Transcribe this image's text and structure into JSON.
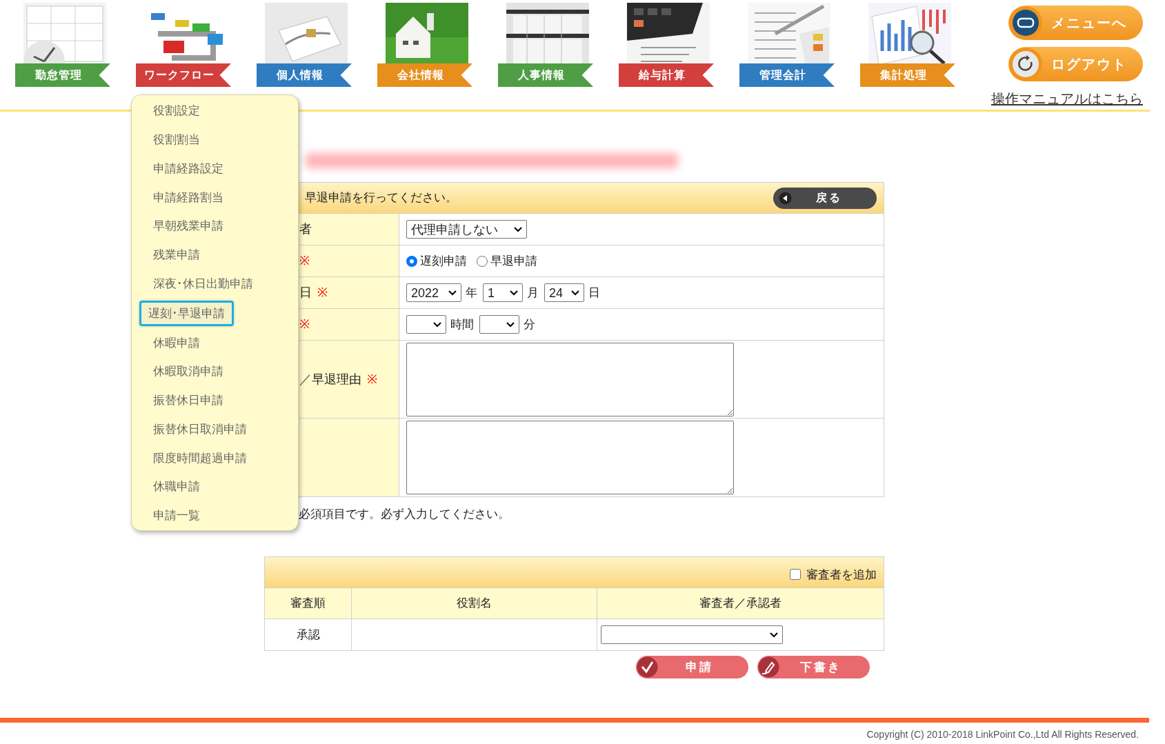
{
  "nav": [
    {
      "label": "勤怠管理",
      "color": "#4f9e45"
    },
    {
      "label": "ワークフロー",
      "color": "#d23f3c"
    },
    {
      "label": "個人情報",
      "color": "#2f7cc0"
    },
    {
      "label": "会社情報",
      "color": "#e68f1c"
    },
    {
      "label": "人事情報",
      "color": "#4f9e45"
    },
    {
      "label": "給与計算",
      "color": "#d23f3c"
    },
    {
      "label": "管理会計",
      "color": "#2f7cc0"
    },
    {
      "label": "集計処理",
      "color": "#e68f1c"
    }
  ],
  "header_buttons": [
    {
      "label": "メニューへ",
      "kind": "menu"
    },
    {
      "label": "ログアウト",
      "kind": "logout"
    }
  ],
  "manual_link": "操作マニュアルはこちら",
  "dropdown": [
    {
      "label": "役割設定",
      "selected": false
    },
    {
      "label": "役割割当",
      "selected": false
    },
    {
      "label": "申請経路設定",
      "selected": false
    },
    {
      "label": "申請経路割当",
      "selected": false
    },
    {
      "label": "早朝残業申請",
      "selected": false
    },
    {
      "label": "残業申請",
      "selected": false
    },
    {
      "label": "深夜･休日出勤申請",
      "selected": false
    },
    {
      "label": "遅刻･早退申請",
      "selected": true
    },
    {
      "label": "休暇申請",
      "selected": false
    },
    {
      "label": "休暇取消申請",
      "selected": false
    },
    {
      "label": "振替休日申請",
      "selected": false
    },
    {
      "label": "振替休日取消申請",
      "selected": false
    },
    {
      "label": "限度時間超過申請",
      "selected": false
    },
    {
      "label": "休職申請",
      "selected": false
    },
    {
      "label": "申請一覧",
      "selected": false
    }
  ],
  "form": {
    "instruction": "早退申請を行ってください。",
    "back_button": "戻る",
    "rows": [
      {
        "label": "者",
        "required": false,
        "kind": "select",
        "value": "代理申請しない"
      },
      {
        "label": "",
        "required": true,
        "kind": "radio",
        "options": [
          {
            "label": "遅刻申請",
            "selected": true
          },
          {
            "label": "早退申請",
            "selected": false
          }
        ]
      },
      {
        "label": "日",
        "required": true,
        "kind": "date",
        "fields": [
          {
            "value": "2022",
            "unit": "年"
          },
          {
            "value": "1",
            "unit": "月"
          },
          {
            "value": "24",
            "unit": "日"
          }
        ]
      },
      {
        "label": "",
        "required": true,
        "kind": "time",
        "fields": [
          {
            "unit": "時間"
          },
          {
            "unit": "分"
          }
        ]
      },
      {
        "label": "／早退理由",
        "required": true,
        "kind": "textarea"
      },
      {
        "label": "",
        "required": false,
        "kind": "textarea"
      }
    ],
    "required_mark": "※",
    "note": "必須項目です。必ず入力してください。"
  },
  "reviewers": {
    "add_checkbox": {
      "label": "審査者を追加",
      "checked": false
    },
    "columns": [
      "審査順",
      "役割名",
      "審査者／承認者"
    ],
    "rows": [
      {
        "order": "承認",
        "role": ""
      }
    ]
  },
  "actions": [
    {
      "label": "申請",
      "kind": "check"
    },
    {
      "label": "下書き",
      "kind": "pen"
    }
  ],
  "copyright": "Copyright (C) 2010-2018 LinkPoint Co.,Ltd All Rights Reserved."
}
